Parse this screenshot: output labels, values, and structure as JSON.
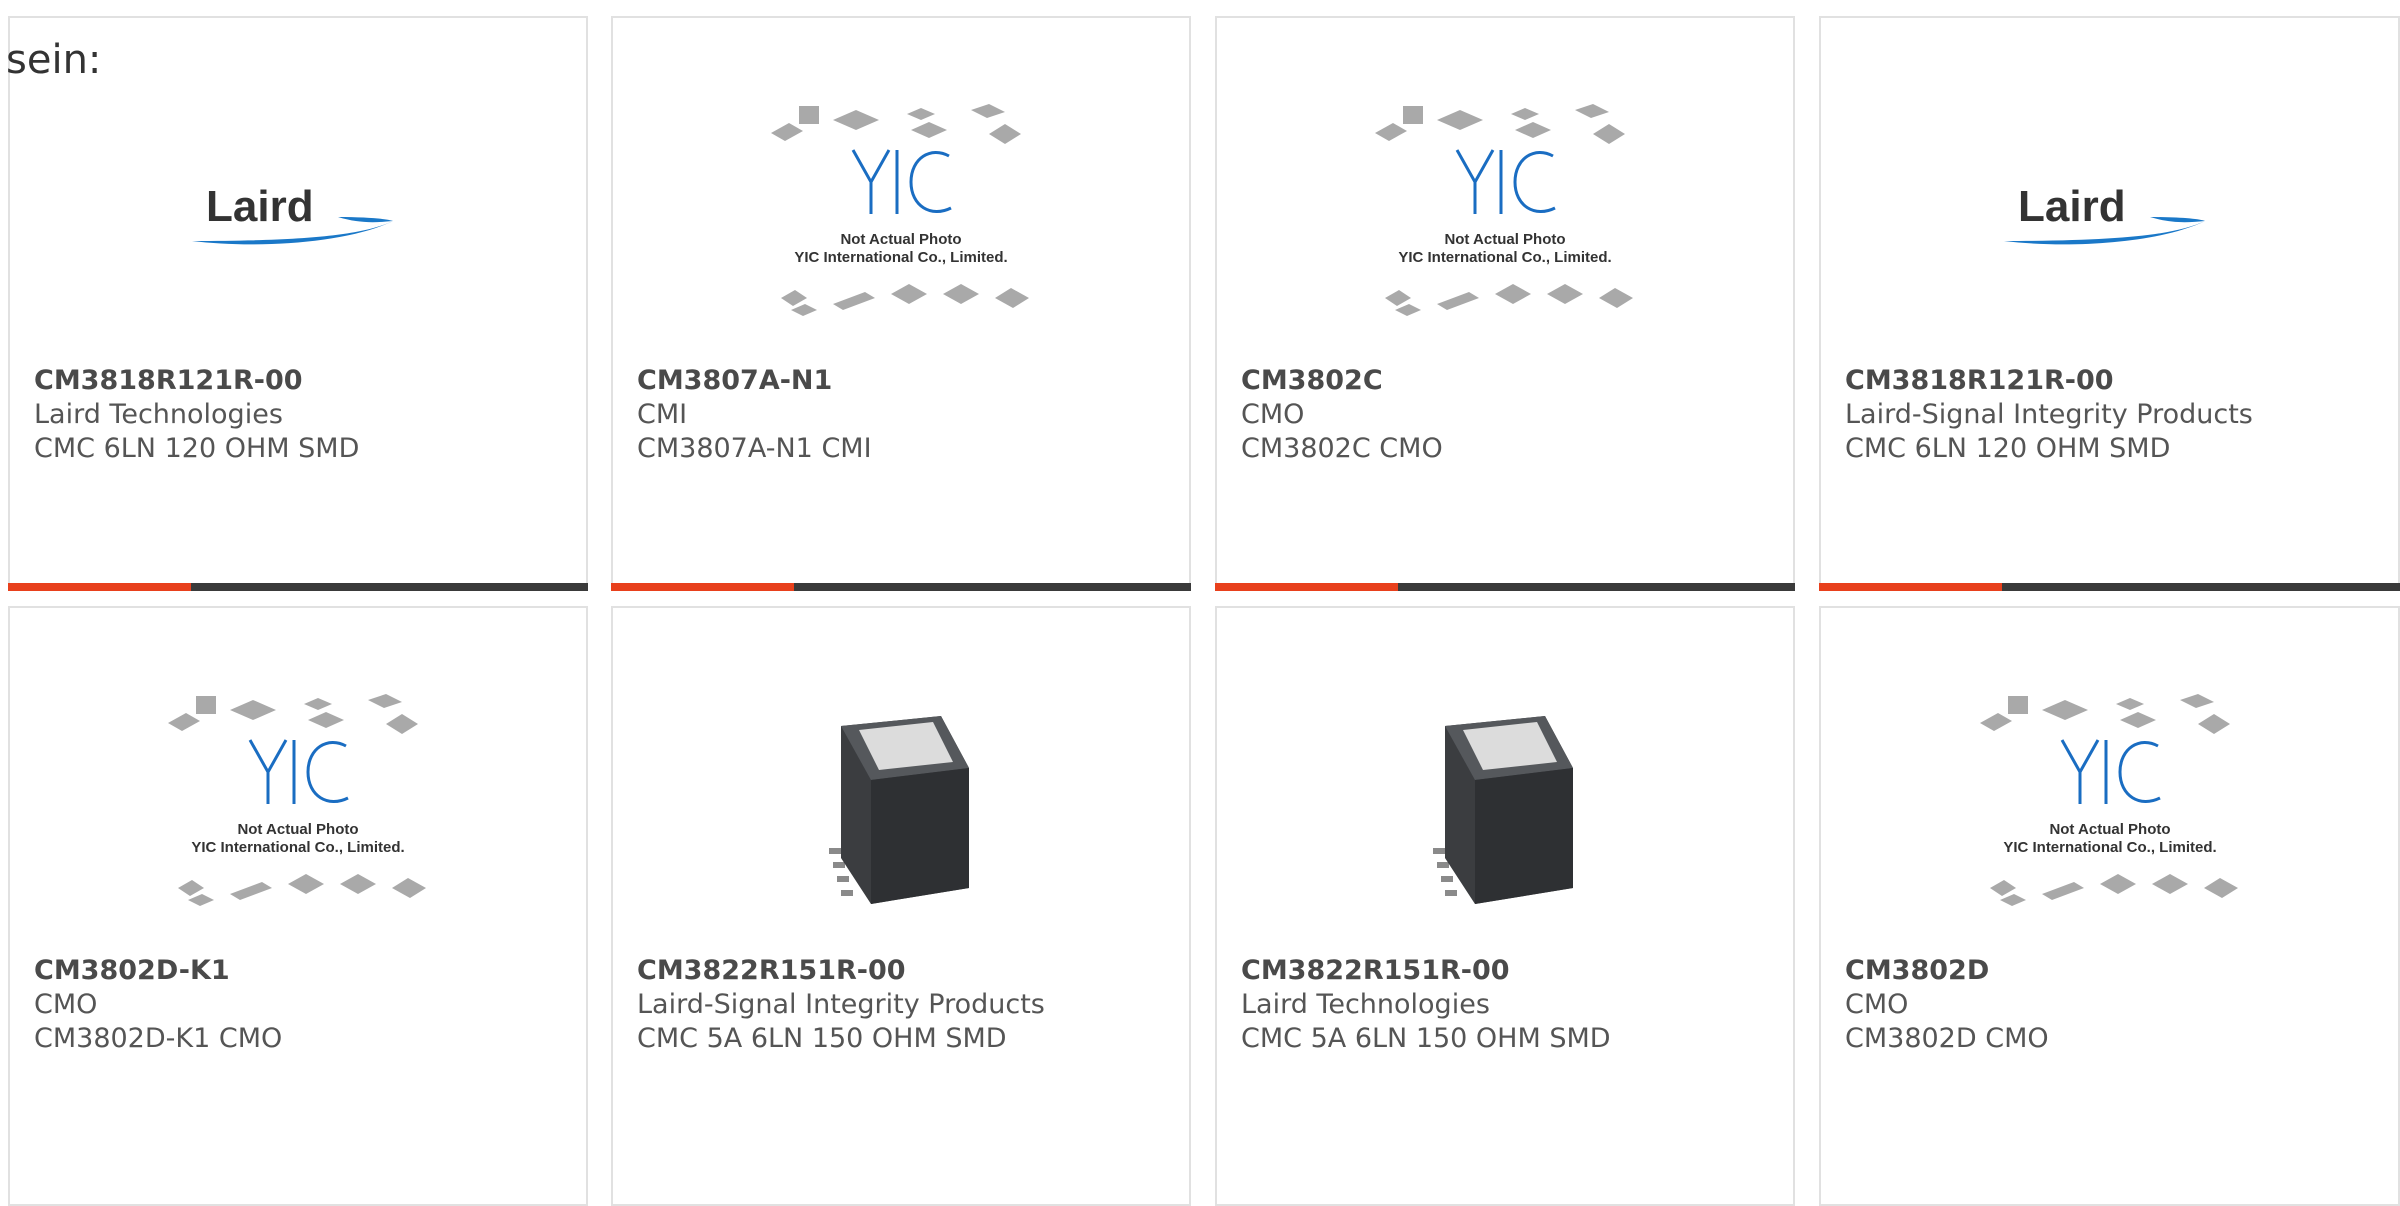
{
  "intro_text": "sein:",
  "colors": {
    "accent": "#e8401c",
    "bar": "#3a3a3a",
    "border": "#e1e1e1",
    "laird_blue": "#1a78c8"
  },
  "products": [
    {
      "part": "CM3818R121R-00",
      "maker": "Laird Technologies",
      "desc": "CMC 6LN 120 OHM SMD",
      "image": "laird-logo",
      "logo_text": "Laird"
    },
    {
      "part": "CM3807A-N1",
      "maker": "CMI",
      "desc": "CM3807A-N1 CMI",
      "image": "yic-placeholder",
      "ph_line1": "Not Actual Photo",
      "ph_line2": "YIC International Co., Limited."
    },
    {
      "part": "CM3802C",
      "maker": "CMO",
      "desc": "CM3802C CMO",
      "image": "yic-placeholder",
      "ph_line1": "Not Actual Photo",
      "ph_line2": "YIC International Co., Limited."
    },
    {
      "part": "CM3818R121R-00",
      "maker": "Laird-Signal Integrity Products",
      "desc": "CMC 6LN 120 OHM SMD",
      "image": "laird-logo",
      "logo_text": "Laird"
    },
    {
      "part": "CM3802D-K1",
      "maker": "CMO",
      "desc": "CM3802D-K1 CMO",
      "image": "yic-placeholder",
      "ph_line1": "Not Actual Photo",
      "ph_line2": "YIC International Co., Limited."
    },
    {
      "part": "CM3822R151R-00",
      "maker": "Laird-Signal Integrity Products",
      "desc": "CMC 5A 6LN 150 OHM SMD",
      "image": "component-photo"
    },
    {
      "part": "CM3822R151R-00",
      "maker": "Laird Technologies",
      "desc": "CMC 5A 6LN 150 OHM SMD",
      "image": "component-photo"
    },
    {
      "part": "CM3802D",
      "maker": "CMO",
      "desc": "CM3802D CMO",
      "image": "yic-placeholder",
      "ph_line1": "Not Actual Photo",
      "ph_line2": "YIC International Co., Limited."
    }
  ]
}
